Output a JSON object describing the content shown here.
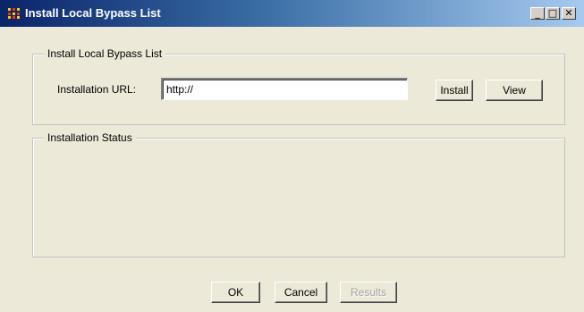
{
  "window": {
    "title": "Install Local Bypass List",
    "controls": {
      "minimize": "_",
      "maximize": "□",
      "close": "✕"
    }
  },
  "bypass_group": {
    "legend": "Install Local Bypass List",
    "url_label": "Installation URL:",
    "url_value": "http://",
    "install_label": "Install",
    "view_label": "View"
  },
  "status_group": {
    "legend": "Installation Status"
  },
  "footer": {
    "ok_label": "OK",
    "cancel_label": "Cancel",
    "results_label": "Results",
    "results_enabled": false
  },
  "colors": {
    "title_bar_start": "#0a246a",
    "title_bar_end": "#a6caf0",
    "dialog_background": "#ece9d8"
  }
}
